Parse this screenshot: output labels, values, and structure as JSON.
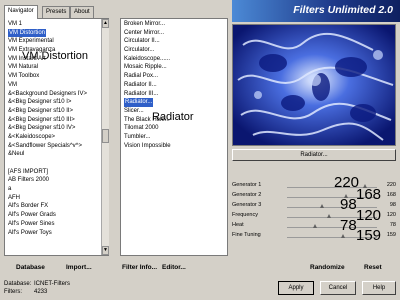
{
  "tabs": [
    "Navigator",
    "Presets",
    "About"
  ],
  "title": "Filters Unlimited 2.0",
  "categories": [
    "VM 1",
    "VM Distortion",
    "VM Experimental",
    "VM Extravaganza",
    "VM Instant Art",
    "VM Natural",
    "VM Toolbox",
    "VM",
    "&<Background Designers IV>",
    "&<Bkg Designer sf10 I>",
    "&<Bkg Designer sf10 II>",
    "&<Bkg Designer sf10 III>",
    "&<Bkg Designer sf10 IV>",
    "&<Kaleidoscope>",
    "&<Sandflower Specials^v^>",
    "&Neul",
    "",
    "[AFS IMPORT]",
    "AB Filters 2000",
    "a",
    "AFH",
    "Alf's Border FX",
    "Alf's Power Grads",
    "Alf's Power Sines",
    "Alf's Power Toys"
  ],
  "filters": [
    "Broken Mirror...",
    "Center Mirror...",
    "Circulator II...",
    "Circulator...",
    "Kaleidoscope......",
    "Mosaic Ripple...",
    "Radial Pox...",
    "Radiator II...",
    "Radiator III...",
    "Radiator...",
    "Slicer...",
    "The Black Hole...",
    "Tilomat 2000",
    "Tumbler...",
    "Vision Impossible"
  ],
  "selected_category": "VM Distortion",
  "selected_filter": "Radiator...",
  "overlay": {
    "category_label": "VM Distortion",
    "filter_label": "Radiator"
  },
  "preview_caption": "Radiator...",
  "params": [
    {
      "label": "Generator 1",
      "value": 220,
      "overlay": "220"
    },
    {
      "label": "Generator 2",
      "value": 168,
      "overlay": "168"
    },
    {
      "label": "Generator 3",
      "value": 98,
      "overlay": "98"
    },
    {
      "label": "Frequency",
      "value": 120,
      "overlay": "120"
    },
    {
      "label": "Heat",
      "value": 78,
      "overlay": "78"
    },
    {
      "label": "Fine Tuning",
      "value": 159,
      "overlay": "159"
    }
  ],
  "param_max": 255,
  "bottom_buttons": {
    "database": "Database",
    "import": "Import...",
    "filter_info": "Filter Info...",
    "editor": "Editor...",
    "randomize": "Randomize",
    "reset": "Reset"
  },
  "status": {
    "database_label": "Database:",
    "database_value": "ICNET-Filters",
    "filters_label": "Filters:",
    "filters_value": "4233"
  },
  "actions": {
    "apply": "Apply",
    "cancel": "Cancel",
    "help": "Help"
  },
  "colors": {
    "selection": "#2f5fc8",
    "banner": "#1e3a8a",
    "preview": "#2034a8"
  }
}
